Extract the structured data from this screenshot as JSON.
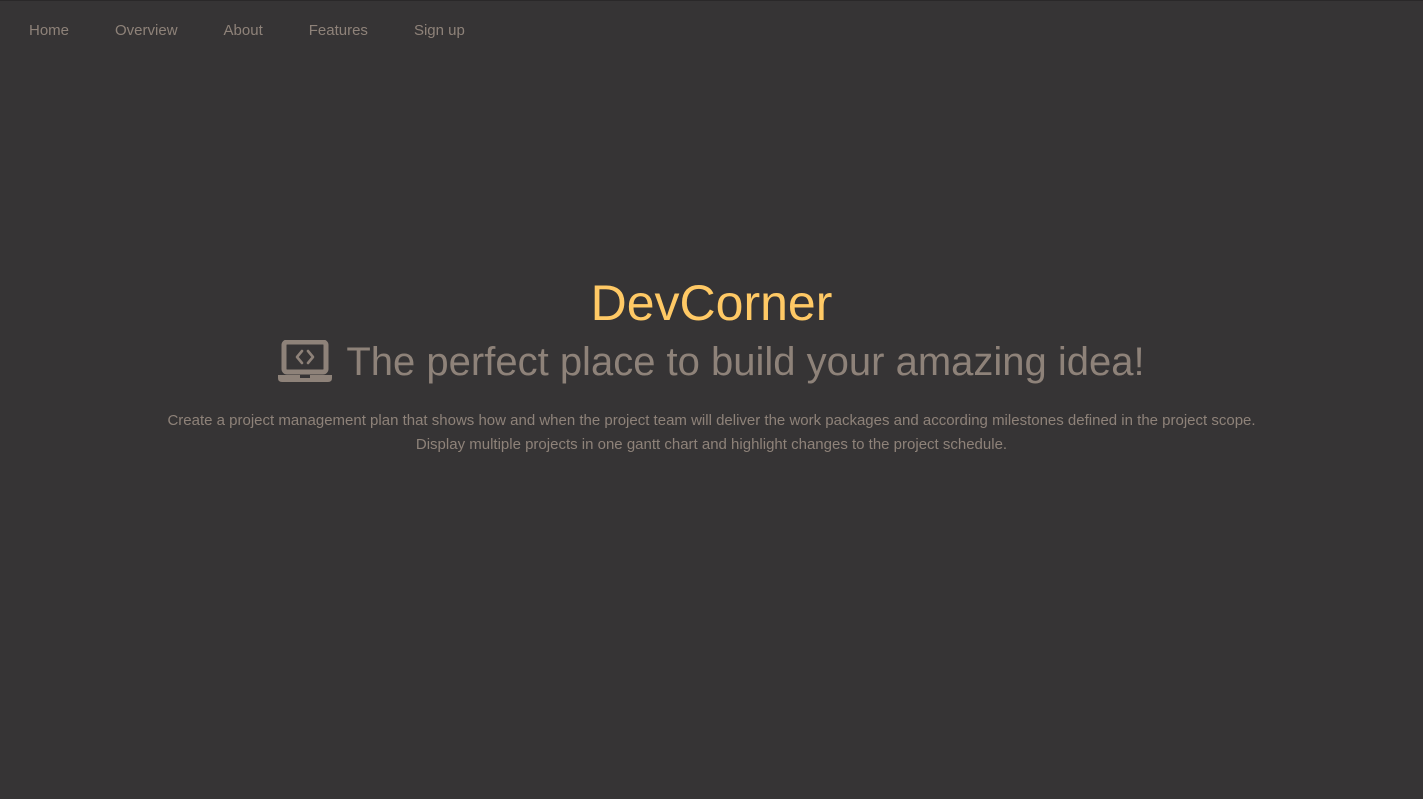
{
  "nav": {
    "items": [
      {
        "label": "Home"
      },
      {
        "label": "Overview"
      },
      {
        "label": "About"
      },
      {
        "label": "Features"
      },
      {
        "label": "Sign up"
      }
    ]
  },
  "hero": {
    "brand": "DevCorner",
    "icon": "laptop-code-icon",
    "tagline": "The perfect place to build your amazing idea!",
    "description_line1": "Create a project management plan that shows how and when the project team will deliver the work packages and according milestones defined in the project scope.",
    "description_line2": "Display multiple projects in one gantt chart and highlight changes to the project schedule."
  },
  "colors": {
    "background": "#363435",
    "accent": "#ffc965",
    "text_muted": "#8e8279"
  }
}
